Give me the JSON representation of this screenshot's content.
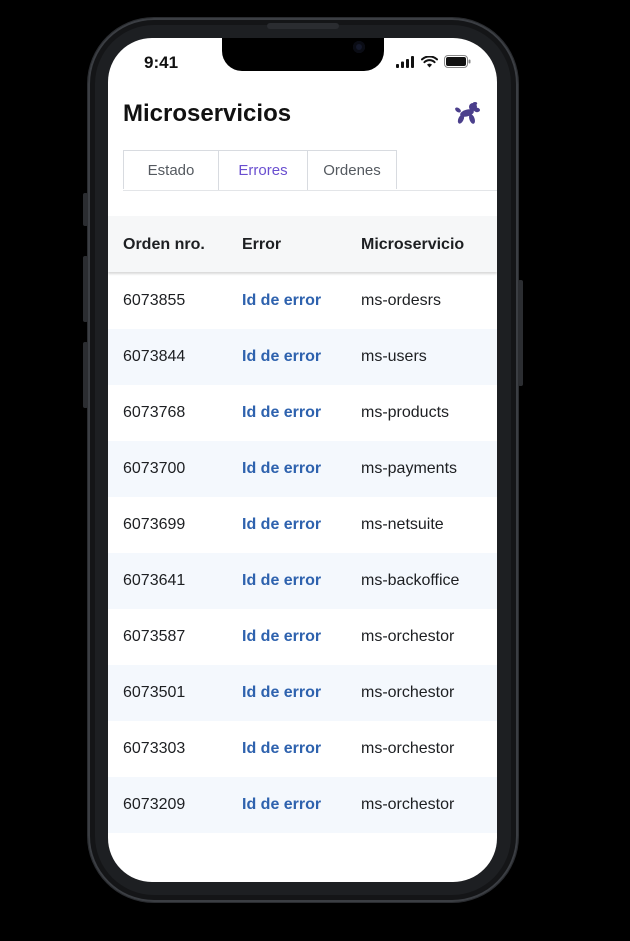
{
  "status_bar": {
    "time": "9:41"
  },
  "header": {
    "title": "Microservicios",
    "logo_icon": "balloon-dog-icon",
    "accent": "#4b3f8c"
  },
  "tabs": [
    {
      "label": "Estado",
      "active": false
    },
    {
      "label": "Errores",
      "active": true
    },
    {
      "label": "Ordenes",
      "active": false
    }
  ],
  "table": {
    "columns": [
      "Orden nro.",
      "Error",
      "Microservicio"
    ],
    "rows": [
      {
        "order": "6073855",
        "error": "Id de error",
        "service": "ms-ordesrs"
      },
      {
        "order": "6073844",
        "error": "Id de error",
        "service": "ms-users"
      },
      {
        "order": "6073768",
        "error": "Id de error",
        "service": "ms-products"
      },
      {
        "order": "6073700",
        "error": "Id de error",
        "service": "ms-payments"
      },
      {
        "order": "6073699",
        "error": "Id de error",
        "service": "ms-netsuite"
      },
      {
        "order": "6073641",
        "error": "Id de error",
        "service": "ms-backoffice"
      },
      {
        "order": "6073587",
        "error": "Id de error",
        "service": "ms-orchestor"
      },
      {
        "order": "6073501",
        "error": "Id de error",
        "service": "ms-orchestor"
      },
      {
        "order": "6073303",
        "error": "Id de error",
        "service": "ms-orchestor"
      },
      {
        "order": "6073209",
        "error": "Id de error",
        "service": "ms-orchestor"
      }
    ]
  }
}
